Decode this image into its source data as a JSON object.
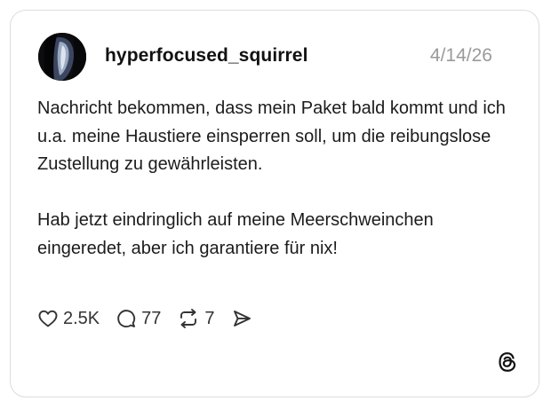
{
  "post": {
    "username": "hyperfocused_squirrel",
    "date": "4/14/26",
    "paragraphs": [
      "Nachricht bekommen, dass mein Paket bald kommt und ich u.a. meine Haustiere einsperren soll, um die reibungslose Zustellung zu gewährleisten.",
      "Hab jetzt eindringlich auf meine Meerschweinchen eingeredet, aber ich garantiere für nix!"
    ]
  },
  "actions": {
    "likes": "2.5K",
    "replies": "77",
    "reposts": "7"
  },
  "icons": {
    "like": "heart-icon",
    "reply": "speech-bubble-icon",
    "repost": "repost-arrows-icon",
    "share": "send-icon",
    "brand": "threads-logo-icon"
  }
}
